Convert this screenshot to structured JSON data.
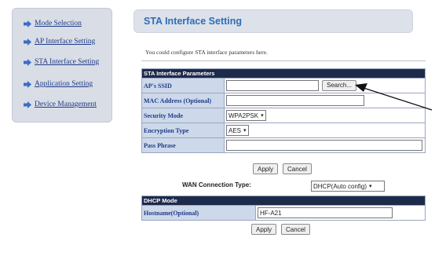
{
  "sidebar": {
    "items": [
      {
        "label": "Mode Selection"
      },
      {
        "label": "AP Interface Setting"
      },
      {
        "label": "STA Interface Setting"
      },
      {
        "label": "Application Setting"
      },
      {
        "label": "Device Management"
      }
    ]
  },
  "header": {
    "title": "STA Interface Setting"
  },
  "intro": "You could configure STA interface parameters here.",
  "sta": {
    "section_title": "STA Interface Parameters",
    "ssid_label": "AP's SSID",
    "ssid_value": "",
    "search_label": "Search...",
    "mac_label": "MAC Address (Optional)",
    "mac_value": "",
    "security_label": "Security Mode",
    "security_value": "WPA2PSK",
    "encryption_label": "Encryption Type",
    "encryption_value": "AES",
    "passphrase_label": "Pass Phrase",
    "passphrase_value": "",
    "apply_label": "Apply",
    "cancel_label": "Cancel"
  },
  "wan": {
    "label": "WAN Connection Type:",
    "value": "DHCP(Auto config)"
  },
  "dhcp": {
    "section_title": "DHCP Mode",
    "hostname_label": "Hostname(Optional)",
    "hostname_value": "HF-A21",
    "apply_label": "Apply",
    "cancel_label": "Cancel"
  },
  "colors": {
    "accent": "#2e6db7",
    "section_header": "#1e2a4a",
    "label_cell": "#cdd8ea",
    "nav_link": "#1f3c88"
  },
  "icons": {
    "nav_bullet": "arrow-right-icon",
    "pointer": "annotation-arrow-icon"
  }
}
